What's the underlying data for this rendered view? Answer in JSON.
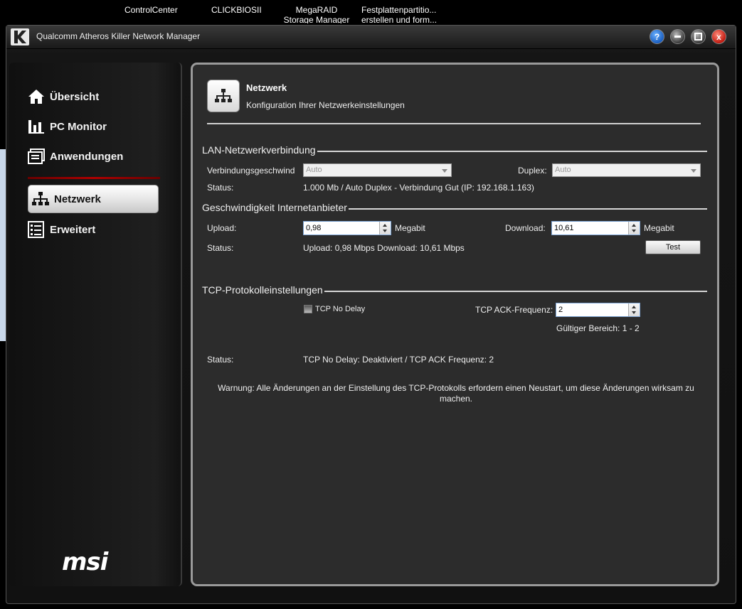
{
  "desktop": {
    "icons": [
      "ControlCenter",
      "CLICKBIOSII",
      "MegaRAID Storage Manager",
      "Festplattenpartitio... erstellen und form..."
    ]
  },
  "window": {
    "title": "Qualcomm Atheros Killer Network Manager",
    "buttons": {
      "help": "?",
      "minimize": "",
      "maximize": "",
      "close": "x"
    }
  },
  "sidebar": {
    "items": [
      {
        "label": "Übersicht",
        "icon": "home-icon"
      },
      {
        "label": "PC Monitor",
        "icon": "bar-chart-icon"
      },
      {
        "label": "Anwendungen",
        "icon": "applications-icon"
      },
      {
        "label": "Netzwerk",
        "icon": "network-icon",
        "active": true
      },
      {
        "label": "Erweitert",
        "icon": "list-settings-icon"
      }
    ],
    "logo": "msi"
  },
  "header": {
    "title": "Netzwerk",
    "subtitle": "Konfiguration Ihrer Netzwerkeinstellungen"
  },
  "lan": {
    "section_title": "LAN-Netzwerkverbindung",
    "speed_label": "Verbindungsgeschwind",
    "speed_value": "Auto",
    "duplex_label": "Duplex:",
    "duplex_value": "Auto",
    "status_label": "Status:",
    "status_value": "1.000 Mb / Auto Duplex - Verbindung Gut (IP: 192.168.1.163)"
  },
  "isp": {
    "section_title": "Geschwindigkeit Internetanbieter",
    "upload_label": "Upload:",
    "upload_value": "0,98",
    "upload_unit": "Megabit",
    "download_label": "Download:",
    "download_value": "10,61",
    "download_unit": "Megabit",
    "status_label": "Status:",
    "status_value": "Upload: 0,98 Mbps Download: 10,61 Mbps",
    "test_button": "Test"
  },
  "tcp": {
    "section_title": "TCP-Protokolleinstellungen",
    "no_delay_label": "TCP No Delay",
    "no_delay_checked": false,
    "ack_label": "TCP ACK-Frequenz:",
    "ack_value": "2",
    "range_text": "Gültiger Bereich: 1 - 2",
    "status_label": "Status:",
    "status_value": "TCP No Delay: Deaktiviert / TCP ACK Frequenz: 2",
    "warning": "Warnung: Alle Änderungen an der Einstellung des TCP-Protokolls erfordern einen Neustart, um diese Änderungen wirksam zu machen."
  }
}
